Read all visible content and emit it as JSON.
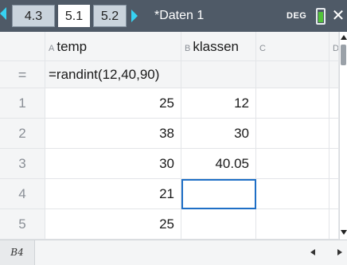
{
  "titlebar": {
    "tabs": [
      {
        "label": "4.3",
        "active": false
      },
      {
        "label": "5.1",
        "active": true
      },
      {
        "label": "5.2",
        "active": false
      }
    ],
    "document_title": "*Daten 1",
    "angle_mode": "DEG",
    "nav_left_icon": "arrow-left-icon",
    "nav_right_icon": "arrow-right-icon",
    "battery_icon": "battery-icon",
    "close_icon": "close-icon",
    "accent_color": "#37d2f2"
  },
  "sheet": {
    "columns": [
      {
        "letter": "A",
        "name": "temp"
      },
      {
        "letter": "B",
        "name": "klassen"
      },
      {
        "letter": "C",
        "name": ""
      },
      {
        "letter": "D",
        "name": ""
      }
    ],
    "formula_row": {
      "symbol": "=",
      "formula": "=randint(12,40,90)"
    },
    "rows": [
      {
        "n": "1",
        "a": "25",
        "b": "12"
      },
      {
        "n": "2",
        "a": "38",
        "b": "30"
      },
      {
        "n": "3",
        "a": "30",
        "b": "40.05"
      },
      {
        "n": "4",
        "a": "21",
        "b": ""
      },
      {
        "n": "5",
        "a": "25",
        "b": ""
      }
    ],
    "selected_cell": "B4",
    "selection_color": "#1f6fc6"
  },
  "statusbar": {
    "cell_reference": "B4"
  }
}
